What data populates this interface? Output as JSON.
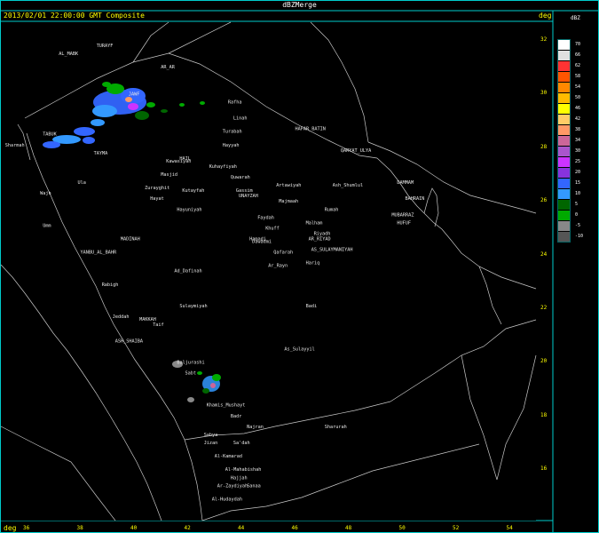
{
  "window": {
    "title": "dBZMerge"
  },
  "header": {
    "timestamp": "2013/02/01 22:00:00 GMT Composite",
    "unit_right": "deg",
    "unit_bottom": "deg"
  },
  "colorbar": {
    "unit": "dBZ",
    "levels": [
      {
        "label": "70",
        "color": "#ffffff"
      },
      {
        "label": "66",
        "color": "#e0e0e0"
      },
      {
        "label": "62",
        "color": "#ff3333"
      },
      {
        "label": "58",
        "color": "#ff5500"
      },
      {
        "label": "54",
        "color": "#ff8800"
      },
      {
        "label": "50",
        "color": "#ffbb00"
      },
      {
        "label": "46",
        "color": "#ffff00"
      },
      {
        "label": "42",
        "color": "#ffcc66"
      },
      {
        "label": "38",
        "color": "#ff9966"
      },
      {
        "label": "34",
        "color": "#cc6699"
      },
      {
        "label": "30",
        "color": "#aa55cc"
      },
      {
        "label": "25",
        "color": "#cc33ff"
      },
      {
        "label": "20",
        "color": "#8833dd"
      },
      {
        "label": "15",
        "color": "#3366ff"
      },
      {
        "label": "10",
        "color": "#3399ff"
      },
      {
        "label": "5",
        "color": "#006600"
      },
      {
        "label": "0",
        "color": "#00aa00"
      },
      {
        "label": "-5",
        "color": "#888888"
      },
      {
        "label": "-10",
        "color": "#555555"
      }
    ]
  },
  "axes": {
    "lat_ticks": [
      "32",
      "30",
      "28",
      "26",
      "24",
      "22",
      "20",
      "18",
      "16"
    ],
    "lon_ticks": [
      "36",
      "38",
      "40",
      "42",
      "44",
      "46",
      "48",
      "50",
      "52",
      "54"
    ]
  },
  "cities": [
    {
      "name": "AL_MABK",
      "lon": 37.2,
      "lat": 31.4
    },
    {
      "name": "TURAYF",
      "lon": 38.6,
      "lat": 31.7
    },
    {
      "name": "AR_AR",
      "lon": 41.0,
      "lat": 30.9
    },
    {
      "name": "JAWF",
      "lon": 39.8,
      "lat": 29.9
    },
    {
      "name": "Rafha",
      "lon": 43.5,
      "lat": 29.6
    },
    {
      "name": "Linah",
      "lon": 43.7,
      "lat": 29.0
    },
    {
      "name": "HAFAR_BATIN",
      "lon": 46.0,
      "lat": 28.6
    },
    {
      "name": "TABUK",
      "lon": 36.6,
      "lat": 28.4
    },
    {
      "name": "Sharmah",
      "lon": 35.2,
      "lat": 28.0
    },
    {
      "name": "Turabah",
      "lon": 43.3,
      "lat": 28.5
    },
    {
      "name": "Hayyah",
      "lon": 43.3,
      "lat": 28.0
    },
    {
      "name": "QARYAT_ULYA",
      "lon": 47.7,
      "lat": 27.8
    },
    {
      "name": "TAYMA",
      "lon": 38.5,
      "lat": 27.7
    },
    {
      "name": "Kawasiyah",
      "lon": 41.2,
      "lat": 27.4
    },
    {
      "name": "HAIL",
      "lon": 41.7,
      "lat": 27.5
    },
    {
      "name": "Kuhayfiyah",
      "lon": 42.8,
      "lat": 27.2
    },
    {
      "name": "Masjid",
      "lon": 41.0,
      "lat": 26.9
    },
    {
      "name": "Quwarah",
      "lon": 43.6,
      "lat": 26.8
    },
    {
      "name": "Ula",
      "lon": 37.9,
      "lat": 26.6
    },
    {
      "name": "Wajh",
      "lon": 36.5,
      "lat": 26.2
    },
    {
      "name": "Zurayghit",
      "lon": 40.4,
      "lat": 26.4
    },
    {
      "name": "Kutayfah",
      "lon": 41.8,
      "lat": 26.3
    },
    {
      "name": "Gassim",
      "lon": 43.8,
      "lat": 26.3
    },
    {
      "name": "UNAYZAH",
      "lon": 43.9,
      "lat": 26.1
    },
    {
      "name": "Artawiyah",
      "lon": 45.3,
      "lat": 26.5
    },
    {
      "name": "Ash_Shumlul",
      "lon": 47.4,
      "lat": 26.5
    },
    {
      "name": "DAMMAM",
      "lon": 49.8,
      "lat": 26.6
    },
    {
      "name": "Hayat",
      "lon": 40.6,
      "lat": 26.0
    },
    {
      "name": "Majmaah",
      "lon": 45.4,
      "lat": 25.9
    },
    {
      "name": "Hayuniyah",
      "lon": 41.6,
      "lat": 25.6
    },
    {
      "name": "Rumah",
      "lon": 47.1,
      "lat": 25.6
    },
    {
      "name": "BAHRAIN",
      "lon": 50.1,
      "lat": 26.0
    },
    {
      "name": "MUBARRAZ",
      "lon": 49.6,
      "lat": 25.4
    },
    {
      "name": "HUFUF",
      "lon": 49.8,
      "lat": 25.1
    },
    {
      "name": "Faydah",
      "lon": 44.6,
      "lat": 25.3
    },
    {
      "name": "Malham",
      "lon": 46.4,
      "lat": 25.1
    },
    {
      "name": "Umm",
      "lon": 36.6,
      "lat": 25.0
    },
    {
      "name": "Khuff",
      "lon": 44.9,
      "lat": 24.9
    },
    {
      "name": "Riyadh",
      "lon": 46.7,
      "lat": 24.7
    },
    {
      "name": "AR_RIYAD",
      "lon": 46.5,
      "lat": 24.5
    },
    {
      "name": "MADINAH",
      "lon": 39.5,
      "lat": 24.5
    },
    {
      "name": "Dawadmi",
      "lon": 44.4,
      "lat": 24.4
    },
    {
      "name": "Hamadi",
      "lon": 44.3,
      "lat": 24.5
    },
    {
      "name": "AS_SULAYMANIYAH",
      "lon": 46.6,
      "lat": 24.1
    },
    {
      "name": "Qafarah",
      "lon": 45.2,
      "lat": 24.0
    },
    {
      "name": "YANBU_AL_BAHR",
      "lon": 38.0,
      "lat": 24.0
    },
    {
      "name": "Hariq",
      "lon": 46.4,
      "lat": 23.6
    },
    {
      "name": "Ar_Rayn",
      "lon": 45.0,
      "lat": 23.5
    },
    {
      "name": "Ad_Dafinah",
      "lon": 41.5,
      "lat": 23.3
    },
    {
      "name": "Rabigh",
      "lon": 38.8,
      "lat": 22.8
    },
    {
      "name": "Sulaymiyah",
      "lon": 41.7,
      "lat": 22.0
    },
    {
      "name": "Badi",
      "lon": 46.4,
      "lat": 22.0
    },
    {
      "name": "Jeddah",
      "lon": 39.2,
      "lat": 21.6
    },
    {
      "name": "MAKKAH",
      "lon": 40.2,
      "lat": 21.5
    },
    {
      "name": "Taif",
      "lon": 40.7,
      "lat": 21.3
    },
    {
      "name": "ASH_SHAIBA",
      "lon": 39.3,
      "lat": 20.7
    },
    {
      "name": "As_Sulayyil",
      "lon": 45.6,
      "lat": 20.4
    },
    {
      "name": "Baljurashi",
      "lon": 41.6,
      "lat": 19.9
    },
    {
      "name": "Sabt",
      "lon": 41.9,
      "lat": 19.5
    },
    {
      "name": "Khamis_Mushayt",
      "lon": 42.7,
      "lat": 18.3
    },
    {
      "name": "Badr",
      "lon": 43.6,
      "lat": 17.9
    },
    {
      "name": "Najran",
      "lon": 44.2,
      "lat": 17.5
    },
    {
      "name": "Sharurah",
      "lon": 47.1,
      "lat": 17.5
    },
    {
      "name": "Sabya",
      "lon": 42.6,
      "lat": 17.2
    },
    {
      "name": "Jizan",
      "lon": 42.6,
      "lat": 16.9
    },
    {
      "name": "Sa'dah",
      "lon": 43.7,
      "lat": 16.9
    },
    {
      "name": "Al-Kamarad",
      "lon": 43.0,
      "lat": 16.4
    },
    {
      "name": "Al-Mahabishah",
      "lon": 43.4,
      "lat": 15.9
    },
    {
      "name": "Hajjah",
      "lon": 43.6,
      "lat": 15.6
    },
    {
      "name": "Ar-Zaydiyah",
      "lon": 43.1,
      "lat": 15.3
    },
    {
      "name": "Sanaa",
      "lon": 44.2,
      "lat": 15.3
    },
    {
      "name": "Al-Hudaydah",
      "lon": 42.9,
      "lat": 14.8
    }
  ]
}
